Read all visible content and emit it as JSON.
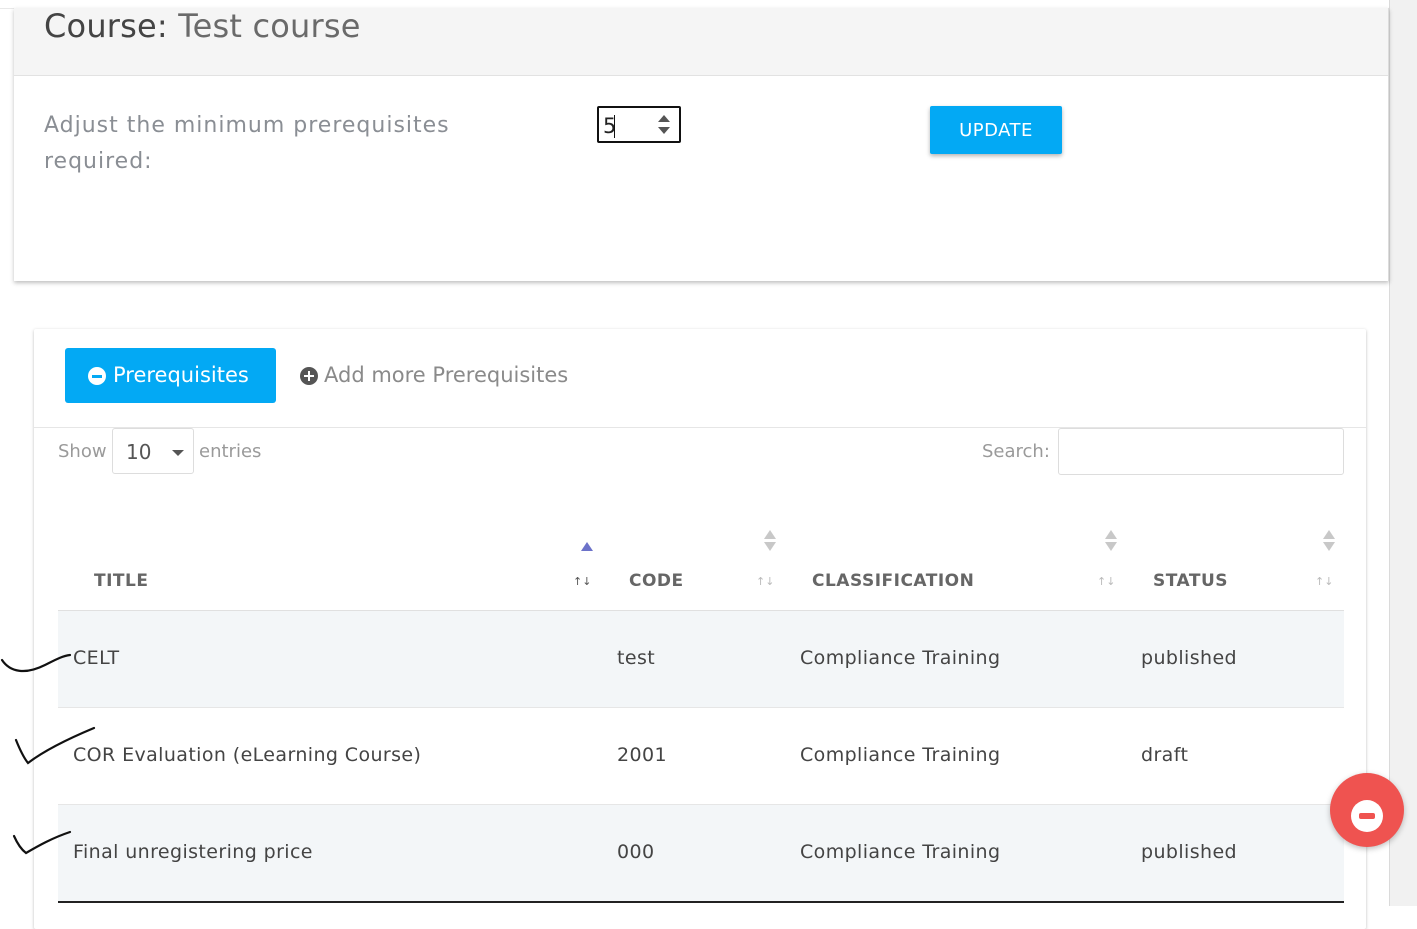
{
  "course": {
    "title_label": "Course:",
    "title_name": "Test course",
    "min_prereq_label": "Adjust the minimum prerequisites required:",
    "min_prereq_value": "5",
    "update_label": "UPDATE"
  },
  "tabs": {
    "prerequisites_label": "Prerequisites",
    "add_more_label": "Add more Prerequisites"
  },
  "table_controls": {
    "show_label": "Show",
    "entries_value": "10",
    "entries_label": "entries",
    "search_label": "Search:",
    "search_value": ""
  },
  "table": {
    "headers": [
      "TITLE",
      "CODE",
      "CLASSIFICATION",
      "STATUS"
    ],
    "rows": [
      {
        "title": "CELT",
        "code": "test",
        "classification": "Compliance Training",
        "status": "published"
      },
      {
        "title": "COR Evaluation (eLearning Course)",
        "code": "2001",
        "classification": "Compliance Training",
        "status": "draft"
      },
      {
        "title": "Final unregistering price",
        "code": "000",
        "classification": "Compliance Training",
        "status": "published"
      }
    ]
  },
  "icons": {
    "tab_active_icon": "minus-circle-icon",
    "tab_add_icon": "plus-circle-icon",
    "fab_icon": "minus-circle-icon"
  },
  "colors": {
    "primary": "#03a9f4",
    "fab": "#ef5350",
    "sort_active": "#6c72c9"
  }
}
